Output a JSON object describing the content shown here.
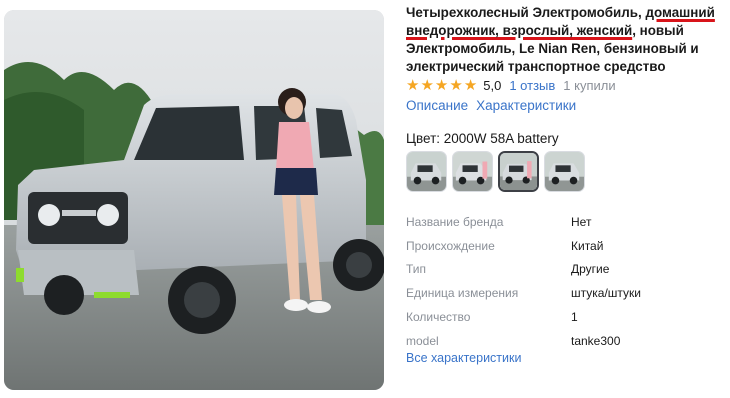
{
  "product": {
    "title_parts": [
      "Четырехколесный Электромобиль, ",
      "домашний внедорожник, взрослый, женский",
      ", новый Электромобиль, Le Nian Ren, бензиновый и электрический транспортное средство"
    ]
  },
  "rating": {
    "stars": 5,
    "value": "5,0",
    "reviews_label": "1 отзыв",
    "bought_label": "1 купили"
  },
  "tabs": [
    {
      "label": "Описание"
    },
    {
      "label": "Характеристики"
    }
  ],
  "color": {
    "label": "Цвет: 2000W 58A battery",
    "thumbnails": [
      {
        "icon": "car-thumbnail",
        "selected": false
      },
      {
        "icon": "car-thumbnail",
        "selected": false
      },
      {
        "icon": "car-thumbnail",
        "selected": true
      },
      {
        "icon": "car-thumbnail",
        "selected": false
      }
    ]
  },
  "specs": [
    {
      "name": "Название бренда",
      "value": "Нет"
    },
    {
      "name": "Происхождение",
      "value": "Китай"
    },
    {
      "name": "Тип",
      "value": "Другие"
    },
    {
      "name": "Единица измерения",
      "value": "штука/штуки"
    },
    {
      "name": "Количество",
      "value": "1"
    },
    {
      "name": "model",
      "value": "tanke300"
    }
  ],
  "all_specs_label": "Все характеристики",
  "colors": {
    "link": "#3a74c9",
    "star": "#f5a623",
    "underline": "#d8141a",
    "muted": "#8a8f97"
  }
}
